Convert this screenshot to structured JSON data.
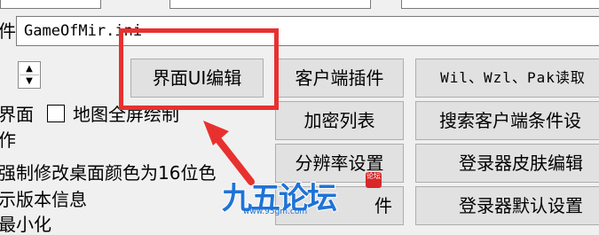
{
  "form": {
    "file_label": "件",
    "file_value": "GameOfMir.ini",
    "spin_up": "▲",
    "spin_down": "▼"
  },
  "buttons": {
    "ui_editor": "界面UI编辑",
    "client_plugin": "客户端插件",
    "wil_reader": "Wil、Wzl、Pak读取",
    "encrypt_list": "加密列表",
    "search_client": "搜索客户端条件设",
    "resolution": "分辨率设置",
    "login_skin": "登录器皮肤编辑",
    "file_partial": "件",
    "login_default": "登录器默认设置"
  },
  "options": {
    "line1_left": "界面",
    "line1_right": "地图全屏绘制",
    "line2": "作",
    "line3": "强制修改桌面颜色为16位色",
    "line4": "示版本信息",
    "line5": "最小化"
  },
  "watermark": {
    "text": "九五论坛",
    "url": "www.95gm.com",
    "seal": "论坛"
  },
  "colors": {
    "highlight": "#e8312f",
    "watermark": "#1f73d6",
    "background": "#f0f0f0",
    "button_face": "#e1e1e1"
  }
}
